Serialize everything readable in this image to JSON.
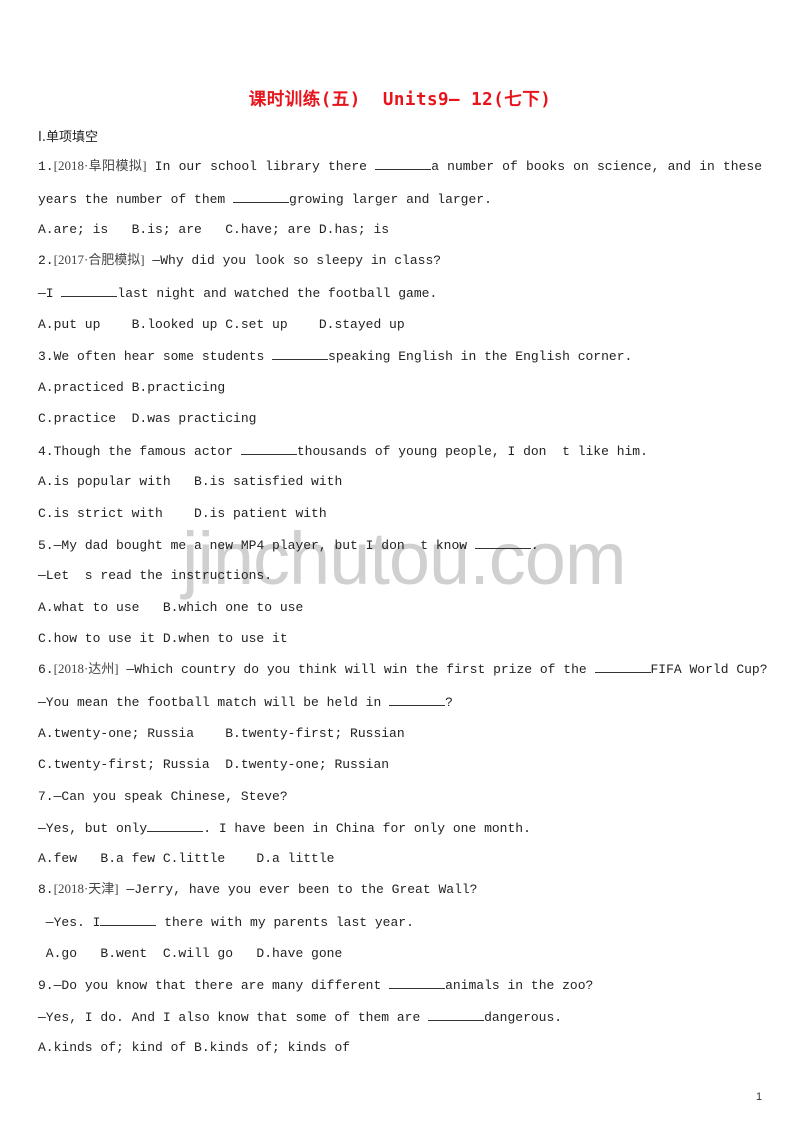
{
  "document": {
    "title": "课时训练(五)  Units9— 12(七下)",
    "title_color": "#e8141c",
    "section_heading": "Ⅰ.单项填空",
    "watermark": "jinchutou.com",
    "page_number": "1"
  },
  "questions": [
    {
      "number": "1.",
      "source": "[2018·阜阳模拟]",
      "lines": [
        {
          "before": " In our school library there ",
          "after": "a number of books on science, and in these"
        },
        {
          "before": "years the number of them ",
          "after": "growing larger and larger."
        }
      ],
      "options": [
        "A.are; is   B.is; are   C.have; are D.has; is"
      ]
    },
    {
      "number": "2.",
      "source": "[2017·合肥模拟]",
      "lines": [
        {
          "text": " —Why did you look so sleepy in class?"
        },
        {
          "before": "—I ",
          "after": "last night and watched the football game."
        }
      ],
      "options": [
        "A.put up    B.looked up C.set up    D.stayed up"
      ]
    },
    {
      "number": "3.",
      "lines": [
        {
          "before": "We often hear some students ",
          "after": "speaking English in the English corner."
        }
      ],
      "options": [
        "A.practiced B.practicing",
        "C.practice  D.was practicing"
      ]
    },
    {
      "number": "4.",
      "lines": [
        {
          "before": "Though the famous actor ",
          "after": "thousands of young people, I don  t like him."
        }
      ],
      "options": [
        "A.is popular with   B.is satisfied with",
        "C.is strict with    D.is patient with"
      ]
    },
    {
      "number": "5.",
      "lines": [
        {
          "before": "—My dad bought me a new MP4 player, but I don  t know ",
          "after": "."
        },
        {
          "text": "—Let  s read the instructions."
        }
      ],
      "options": [
        "A.what to use   B.which one to use",
        "C.how to use it D.when to use it"
      ]
    },
    {
      "number": "6.",
      "source": "[2018·达州]",
      "lines": [
        {
          "before": " —Which country do you think will win the first prize of the ",
          "after": "FIFA World Cup?"
        },
        {
          "before": "—You mean the football match will be held in ",
          "after": "?"
        }
      ],
      "options": [
        "A.twenty-one; Russia    B.twenty-first; Russian",
        "C.twenty-first; Russia  D.twenty-one; Russian"
      ]
    },
    {
      "number": "7.",
      "lines": [
        {
          "text": "—Can you speak Chinese, Steve?"
        },
        {
          "before": "—Yes, but only",
          "after": ". I have been in China for only one month."
        }
      ],
      "options": [
        "A.few   B.a few C.little    D.a little"
      ]
    },
    {
      "number": "8.",
      "source": "[2018·天津]",
      "lines": [
        {
          "text": " —Jerry, have you ever been to the Great Wall?"
        },
        {
          "before": " —Yes. I",
          "after": " there with my parents last year."
        }
      ],
      "options": [
        " A.go   B.went  C.will go   D.have gone"
      ]
    },
    {
      "number": "9.",
      "lines": [
        {
          "before": "—Do you know that there are many different ",
          "after": "animals in the zoo?"
        },
        {
          "before": "—Yes, I do. And I also know that some of them are ",
          "after": "dangerous."
        }
      ],
      "options": [
        "A.kinds of; kind of B.kinds of; kinds of"
      ]
    }
  ]
}
